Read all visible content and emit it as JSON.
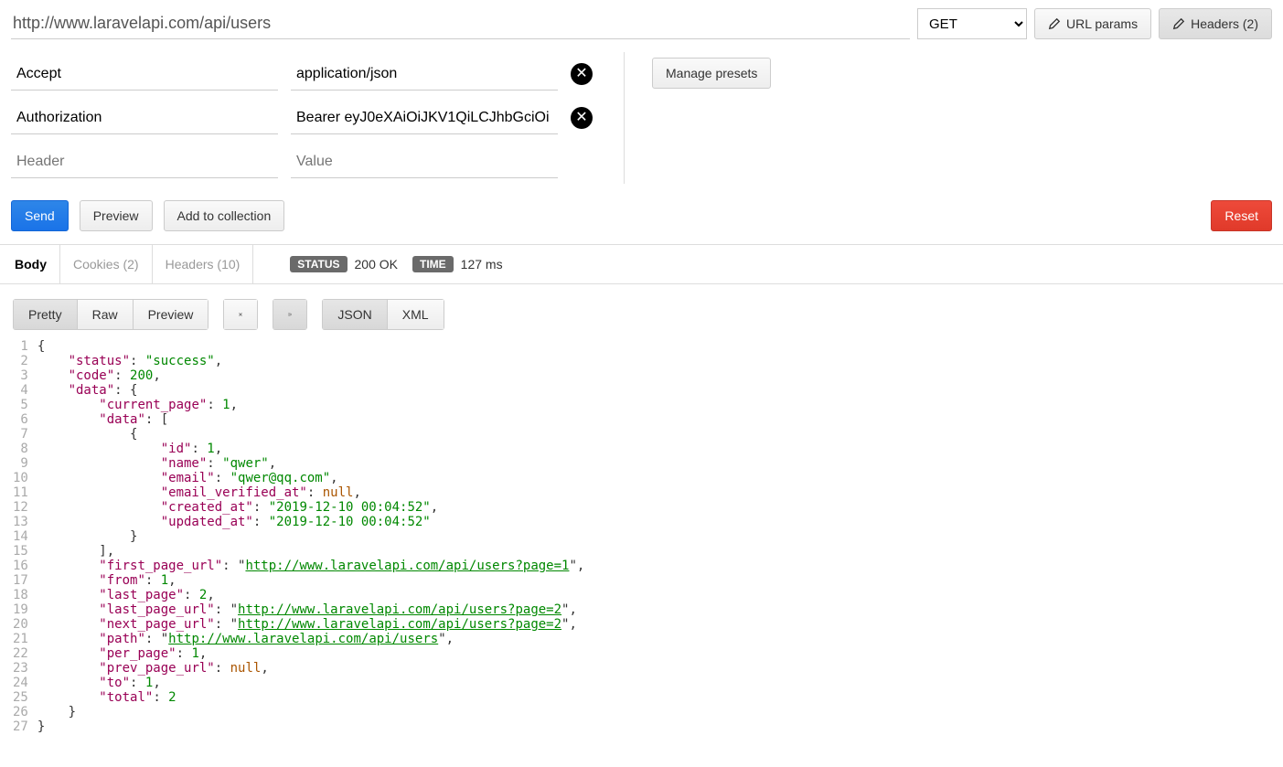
{
  "url": "http://www.laravelapi.com/api/users",
  "method": "GET",
  "top_buttons": {
    "url_params": "URL params",
    "headers": "Headers (2)"
  },
  "headers": {
    "rows": [
      {
        "key": "Accept",
        "value": "application/json"
      },
      {
        "key": "Authorization",
        "value": "Bearer eyJ0eXAiOiJKV1QiLCJhbGciOi"
      }
    ],
    "placeholder_key": "Header",
    "placeholder_value": "Value",
    "manage_presets": "Manage presets"
  },
  "actions": {
    "send": "Send",
    "preview": "Preview",
    "add_to_collection": "Add to collection",
    "reset": "Reset"
  },
  "response_tabs": {
    "body": "Body",
    "cookies": "Cookies (2)",
    "headers": "Headers (10)"
  },
  "status": {
    "label": "STATUS",
    "value": "200 OK",
    "time_label": "TIME",
    "time_value": "127 ms"
  },
  "viewer": {
    "modes": {
      "pretty": "Pretty",
      "raw": "Raw",
      "preview": "Preview"
    },
    "formats": {
      "json": "JSON",
      "xml": "XML"
    }
  },
  "response_body": {
    "status": "success",
    "code": 200,
    "data": {
      "current_page": 1,
      "data": [
        {
          "id": 1,
          "name": "qwer",
          "email": "qwer@qq.com",
          "email_verified_at": null,
          "created_at": "2019-12-10 00:04:52",
          "updated_at": "2019-12-10 00:04:52"
        }
      ],
      "first_page_url": "http://www.laravelapi.com/api/users?page=1",
      "from": 1,
      "last_page": 2,
      "last_page_url": "http://www.laravelapi.com/api/users?page=2",
      "next_page_url": "http://www.laravelapi.com/api/users?page=2",
      "path": "http://www.laravelapi.com/api/users",
      "per_page": 1,
      "prev_page_url": null,
      "to": 1,
      "total": 2
    }
  }
}
